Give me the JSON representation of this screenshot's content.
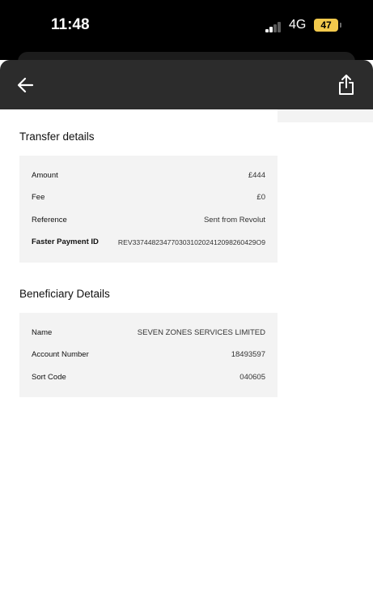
{
  "status_bar": {
    "time": "11:48",
    "network": "4G",
    "battery": "47"
  },
  "nav": {
    "back_icon": "back-arrow-icon",
    "share_icon": "share-icon"
  },
  "transfer": {
    "title": "Transfer details",
    "rows": [
      {
        "label": "Amount",
        "value": "£444"
      },
      {
        "label": "Fee",
        "value": "£0"
      },
      {
        "label": "Reference",
        "value": "Sent from Revolut"
      },
      {
        "label": "Faster Payment ID",
        "value": "REV33744823477030310202412098260429O9"
      }
    ]
  },
  "beneficiary": {
    "title": "Beneficiary Details",
    "rows": [
      {
        "label": "Name",
        "value": "SEVEN ZONES SERVICES LIMITED"
      },
      {
        "label": "Account Number",
        "value": "18493597"
      },
      {
        "label": "Sort Code",
        "value": "040605"
      }
    ]
  }
}
